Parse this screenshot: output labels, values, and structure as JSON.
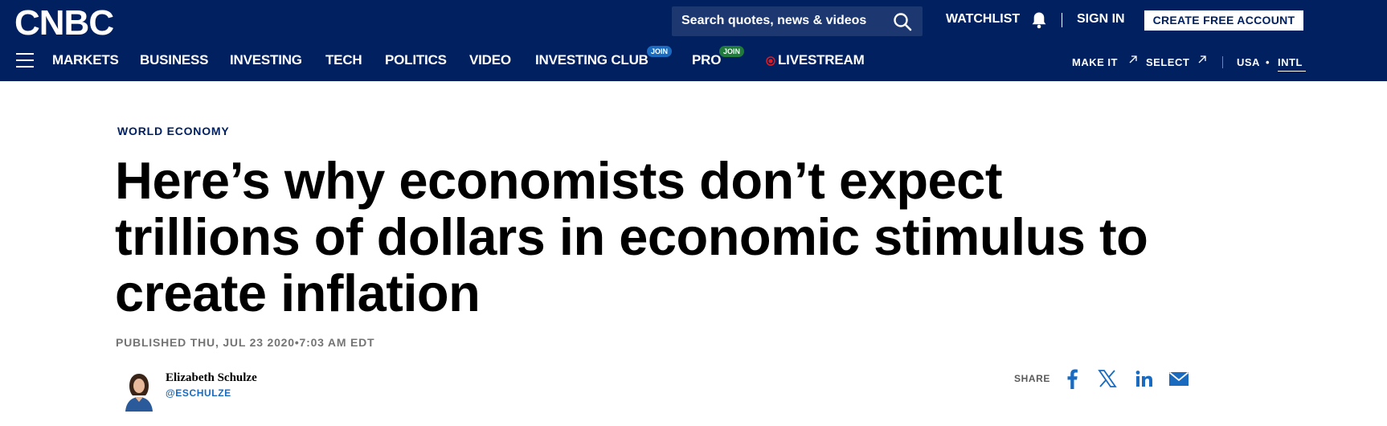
{
  "brand": {
    "logo_text": "CNBC",
    "colors": {
      "nav_bg": "#002060",
      "accent_blue": "#1a6bbf",
      "live_red": "#e01b22"
    }
  },
  "header": {
    "search_placeholder": "Search quotes, news & videos",
    "watchlist_label": "WATCHLIST",
    "signin_label": "SIGN IN",
    "create_account_label": "CREATE FREE ACCOUNT"
  },
  "nav": {
    "items": [
      {
        "label": "MARKETS"
      },
      {
        "label": "BUSINESS"
      },
      {
        "label": "INVESTING"
      },
      {
        "label": "TECH"
      },
      {
        "label": "POLITICS"
      },
      {
        "label": "VIDEO"
      },
      {
        "label": "INVESTING CLUB",
        "badge": "JOIN",
        "badge_color": "#1a6bbf"
      },
      {
        "label": "PRO",
        "badge": "JOIN",
        "badge_color": "#1f7a3c"
      },
      {
        "label": "LIVESTREAM"
      }
    ],
    "right": {
      "make_it": "MAKE IT",
      "select": "SELECT",
      "usa": "USA",
      "dot": "•",
      "intl": "INTL"
    }
  },
  "article": {
    "kicker": "WORLD ECONOMY",
    "headline": "Here’s why economists don’t expect trillions of dollars in economic stimulus to create inflation",
    "published": "PUBLISHED THU, JUL 23 2020•7:03 AM EDT",
    "author": {
      "name": "Elizabeth Schulze",
      "handle": "@ESCHULZE"
    },
    "share_label": "SHARE",
    "share_icons": [
      "facebook-icon",
      "x-icon",
      "linkedin-icon",
      "email-icon"
    ]
  }
}
